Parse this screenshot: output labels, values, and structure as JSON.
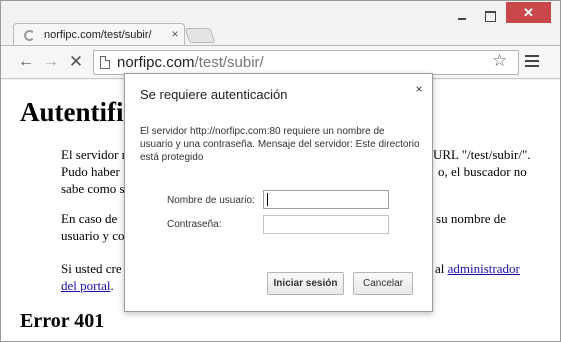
{
  "browser": {
    "tab": {
      "title": "norfipc.com/test/subir/",
      "close": "×"
    },
    "window_controls": {
      "close": "✕"
    },
    "toolbar": {
      "back": "←",
      "forward": "→",
      "reload": "✕",
      "url_host": "norfipc.com",
      "url_path": "/test/subir/",
      "bookmark": "☆"
    }
  },
  "page": {
    "heading": "Autentifi",
    "paragraph1_left": "El servidor r\nPudo haber\nsabe como s",
    "paragraph1_right_line1": "URL \"/test/subir/\".",
    "paragraph1_right_line2": "o, el buscador no",
    "paragraph2_left": "En caso de\nusuario y co",
    "paragraph2_right": "e su nombre de",
    "paragraph3_left_line1": "Si usted cre",
    "paragraph3_right_text": "al ",
    "link_part1": "administrador",
    "link_part2": "del portal",
    "link_suffix": ".",
    "error_heading": "Error 401"
  },
  "dialog": {
    "title": "Se requiere autenticación",
    "close": "×",
    "message": "El servidor http://norfipc.com:80 requiere un nombre de usuario y una contraseña. Mensaje del servidor: Este directorio está protegido",
    "username_label": "Nombre de usuario:",
    "password_label": "Contraseña:",
    "username_value": "",
    "password_value": "",
    "login_button": "Iniciar sesión",
    "cancel_button": "Cancelar"
  },
  "colors": {
    "close_button": "#c7474b",
    "link": "#1a0dab"
  }
}
